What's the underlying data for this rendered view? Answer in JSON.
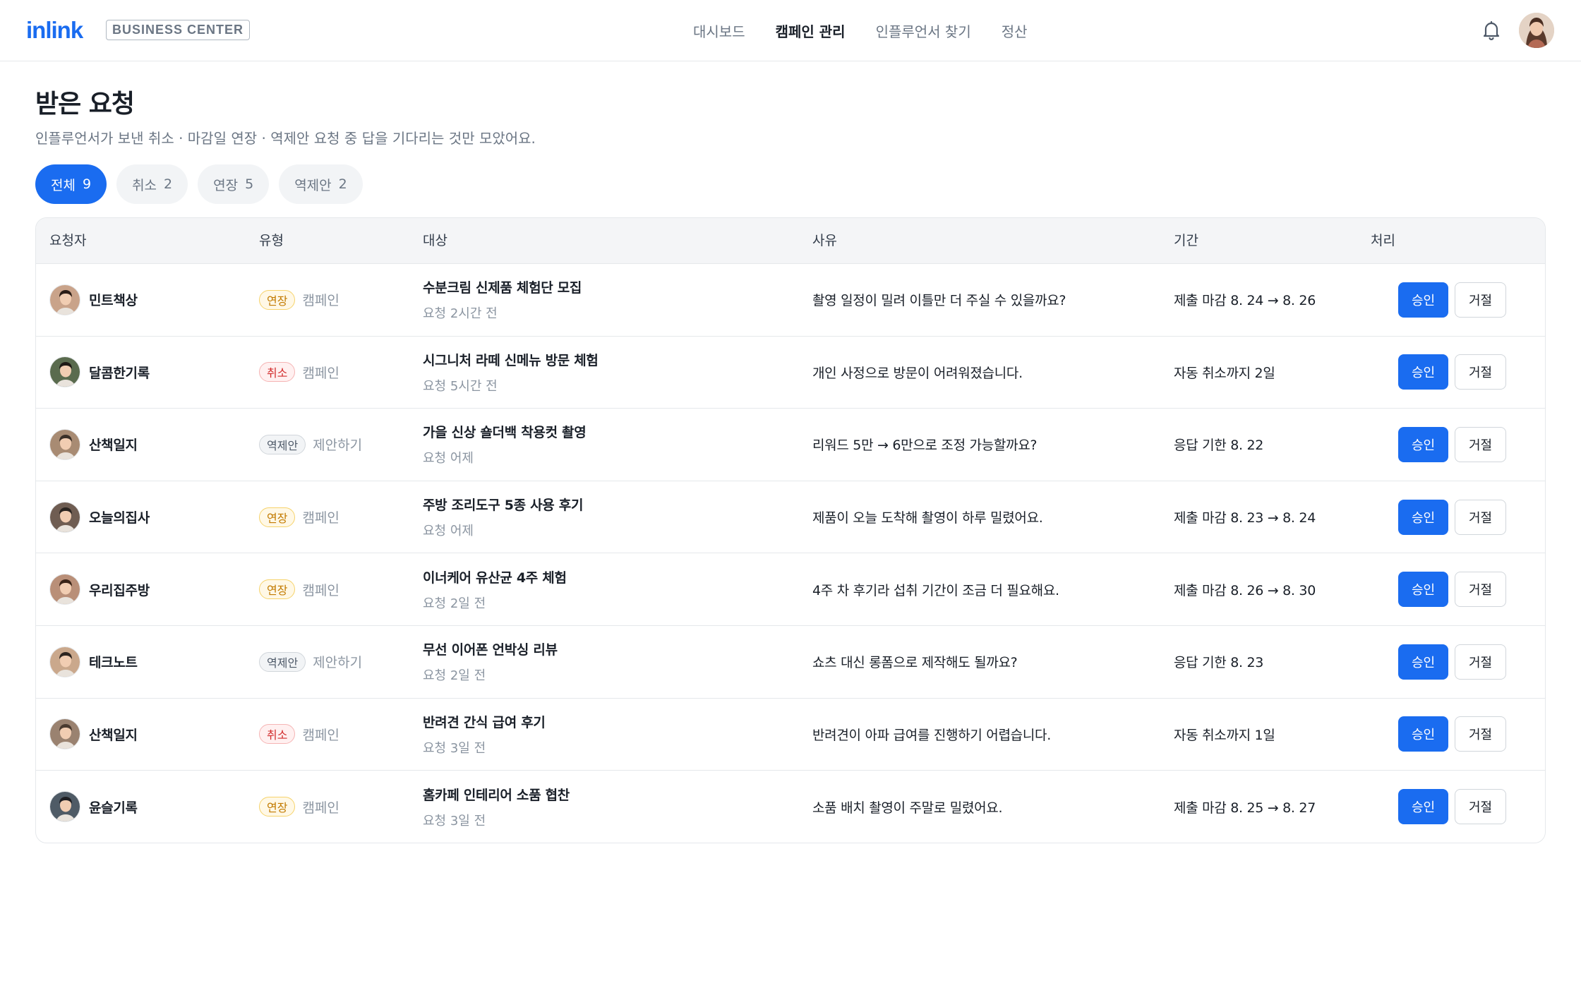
{
  "header": {
    "logo": "inlink",
    "tag": "BUSINESS CENTER",
    "nav": [
      {
        "label": "대시보드",
        "active": false
      },
      {
        "label": "캠페인 관리",
        "active": true
      },
      {
        "label": "인플루언서 찾기",
        "active": false
      },
      {
        "label": "정산",
        "active": false
      }
    ],
    "icons": {
      "bell": "bell-icon",
      "profile": "avatar"
    }
  },
  "page": {
    "title": "받은 요청",
    "description": "인플루언서가 보낸 취소 · 마감일 연장 · 역제안 요청 중 답을 기다리는 것만 모았어요."
  },
  "filters": [
    {
      "label": "전체",
      "count": "9",
      "active": true
    },
    {
      "label": "취소",
      "count": "2",
      "active": false
    },
    {
      "label": "연장",
      "count": "5",
      "active": false
    },
    {
      "label": "역제안",
      "count": "2",
      "active": false
    }
  ],
  "table": {
    "columns": [
      "요청자",
      "유형",
      "대상",
      "사유",
      "기간",
      "처리"
    ],
    "approve_label": "승인",
    "reject_label": "거절",
    "rows": [
      {
        "requester": "민트책상",
        "type": "연장",
        "type_kind": "ext",
        "type_sub": "캠페인",
        "target": "수분크림 신제품 체험단 모집",
        "requested": "요청 2시간 전",
        "reason": "촬영 일정이 밀려 이틀만 더 주실 수 있을까요?",
        "period": "제출 마감 8. 24 → 8. 26",
        "avatar_color": "#c9a38a"
      },
      {
        "requester": "달콤한기록",
        "type": "취소",
        "type_kind": "cancel",
        "type_sub": "캠페인",
        "target": "시그니처 라떼 신메뉴 방문 체험",
        "requested": "요청 5시간 전",
        "reason": "개인 사정으로 방문이 어려워졌습니다.",
        "period": "자동 취소까지 2일",
        "avatar_color": "#5a6b4e"
      },
      {
        "requester": "산책일지",
        "type": "역제안",
        "type_kind": "counter",
        "type_sub": "제안하기",
        "target": "가을 신상 숄더백 착용컷 촬영",
        "requested": "요청 어제",
        "reason": "리워드 5만 → 6만으로 조정 가능할까요?",
        "period": "응답 기한 8. 22",
        "avatar_color": "#a88b73"
      },
      {
        "requester": "오늘의집사",
        "type": "연장",
        "type_kind": "ext",
        "type_sub": "캠페인",
        "target": "주방 조리도구 5종 사용 후기",
        "requested": "요청 어제",
        "reason": "제품이 오늘 도착해 촬영이 하루 밀렸어요.",
        "period": "제출 마감 8. 23 → 8. 24",
        "avatar_color": "#6f5d52"
      },
      {
        "requester": "우리집주방",
        "type": "연장",
        "type_kind": "ext",
        "type_sub": "캠페인",
        "target": "이너케어 유산균 4주 체험",
        "requested": "요청 2일 전",
        "reason": "4주 차 후기라 섭취 기간이 조금 더 필요해요.",
        "period": "제출 마감 8. 26 → 8. 30",
        "avatar_color": "#b98f78"
      },
      {
        "requester": "테크노트",
        "type": "역제안",
        "type_kind": "counter",
        "type_sub": "제안하기",
        "target": "무선 이어폰 언박싱 리뷰",
        "requested": "요청 2일 전",
        "reason": "쇼츠 대신 롱폼으로 제작해도 될까요?",
        "period": "응답 기한 8. 23",
        "avatar_color": "#caa88c"
      },
      {
        "requester": "산책일지",
        "type": "취소",
        "type_kind": "cancel",
        "type_sub": "캠페인",
        "target": "반려견 간식 급여 후기",
        "requested": "요청 3일 전",
        "reason": "반려견이 아파 급여를 진행하기 어렵습니다.",
        "period": "자동 취소까지 1일",
        "avatar_color": "#9a8270"
      },
      {
        "requester": "윤슬기록",
        "type": "연장",
        "type_kind": "ext",
        "type_sub": "캠페인",
        "target": "홈카페 인테리어 소품 협찬",
        "requested": "요청 3일 전",
        "reason": "소품 배치 촬영이 주말로 밀렸어요.",
        "period": "제출 마감 8. 25 → 8. 27",
        "avatar_color": "#4f5b66"
      }
    ]
  },
  "colors": {
    "accent": "#1a6cf0",
    "ext": "#c27a00",
    "cancel": "#d22d2d"
  }
}
